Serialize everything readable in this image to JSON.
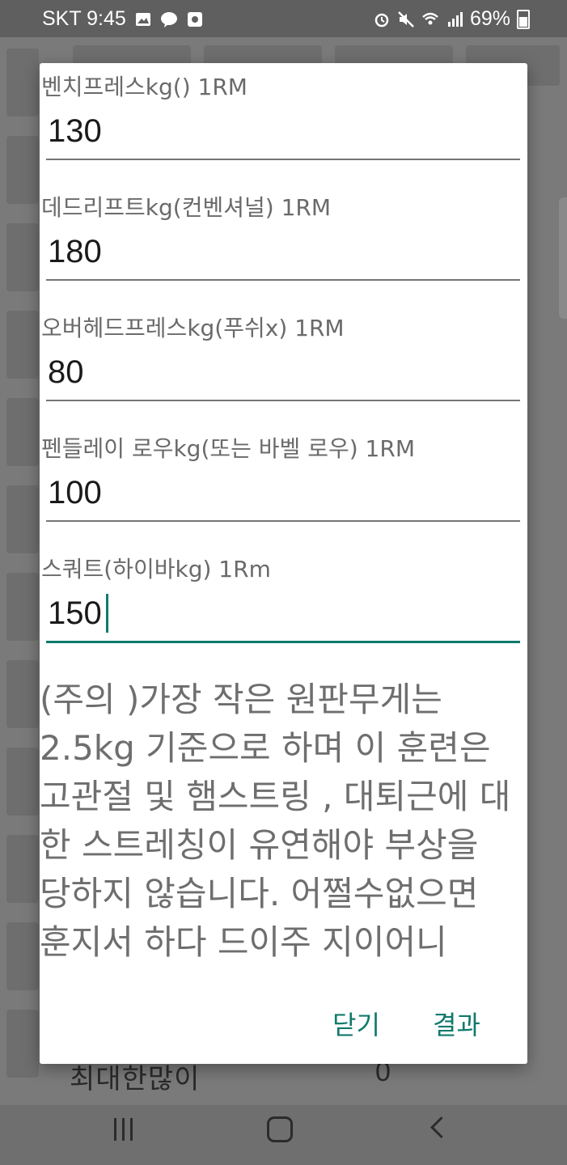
{
  "status_bar": {
    "carrier_time": "SKT 9:45",
    "battery_percent": "69%",
    "left_icons": [
      "gallery-icon",
      "kakaotalk-icon",
      "message-icon"
    ],
    "right_icons": [
      "alarm-icon",
      "mute-icon",
      "wifi-icon",
      "signal-icon",
      "battery-icon"
    ]
  },
  "background": {
    "footer_label": "최대한많이",
    "footer_value": "0"
  },
  "dialog": {
    "fields": [
      {
        "label": "벤치프레스kg() 1RM",
        "value": "130"
      },
      {
        "label": "데드리프트kg(컨벤셔널) 1RM",
        "value": "180"
      },
      {
        "label": "오버헤드프레스kg(푸쉬x) 1RM",
        "value": "80"
      },
      {
        "label": "펜들레이 로우kg(또는 바벨 로우) 1RM",
        "value": "100"
      },
      {
        "label": "스쿼트(하이바kg) 1Rm",
        "value": "150"
      }
    ],
    "notice": "(주의 )가장 작은 원판무게는 2.5kg 기준으로 하며 이 훈련은 고관절 및 햄스트링 , 대퇴근에 대한 스트레칭이 유연해야 부상을 당하지 않습니다. 어쩔수없으면 훈지서 하다 드이주 지이어니",
    "buttons": {
      "close": "닫기",
      "result": "결과"
    }
  },
  "colors": {
    "accent": "#0f7a6c",
    "scrim": "#7b7b7b",
    "dialog_bg": "#ffffff"
  }
}
